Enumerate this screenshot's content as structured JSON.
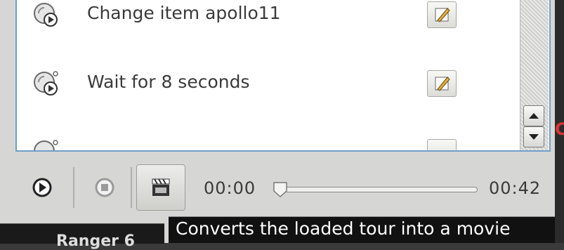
{
  "tour_items": [
    {
      "label": "Change item apollo11"
    },
    {
      "label": "Wait for 8 seconds"
    },
    {
      "label": ""
    }
  ],
  "controls": {
    "current_time": "00:00",
    "total_time": "00:42",
    "progress": 0
  },
  "tooltip": "Converts the loaded tour into a movie",
  "background_text": "Ranger 6",
  "icons": {
    "tour_item": "tour-item-icon",
    "edit": "edit-pencil-icon",
    "play": "play-icon",
    "stop": "stop-icon",
    "movie": "movie-clapper-icon",
    "scroll_up": "scroll-up-arrow-icon",
    "scroll_down": "scroll-down-arrow-icon"
  }
}
